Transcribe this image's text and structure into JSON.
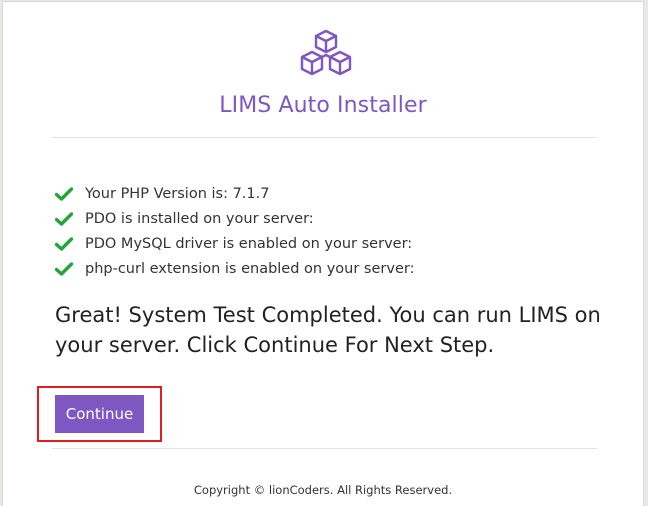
{
  "header": {
    "logo_icon": "boxes-icon",
    "title": "LIMS Auto Installer",
    "accent_color": "#7e57c2"
  },
  "checks": [
    {
      "icon": "check-icon",
      "text": "Your PHP Version is: 7.1.7"
    },
    {
      "icon": "check-icon",
      "text": "PDO is installed on your server:"
    },
    {
      "icon": "check-icon",
      "text": "PDO MySQL driver is enabled on your server:"
    },
    {
      "icon": "check-icon",
      "text": "php-curl extension is enabled on your server:"
    }
  ],
  "check_color": "#22a63a",
  "message": "Great! System Test Completed. You can run LIMS on your server. Click Continue For Next Step.",
  "actions": {
    "continue_label": "Continue"
  },
  "footer": {
    "copyright": "Copyright © lionCoders. All Rights Reserved."
  }
}
